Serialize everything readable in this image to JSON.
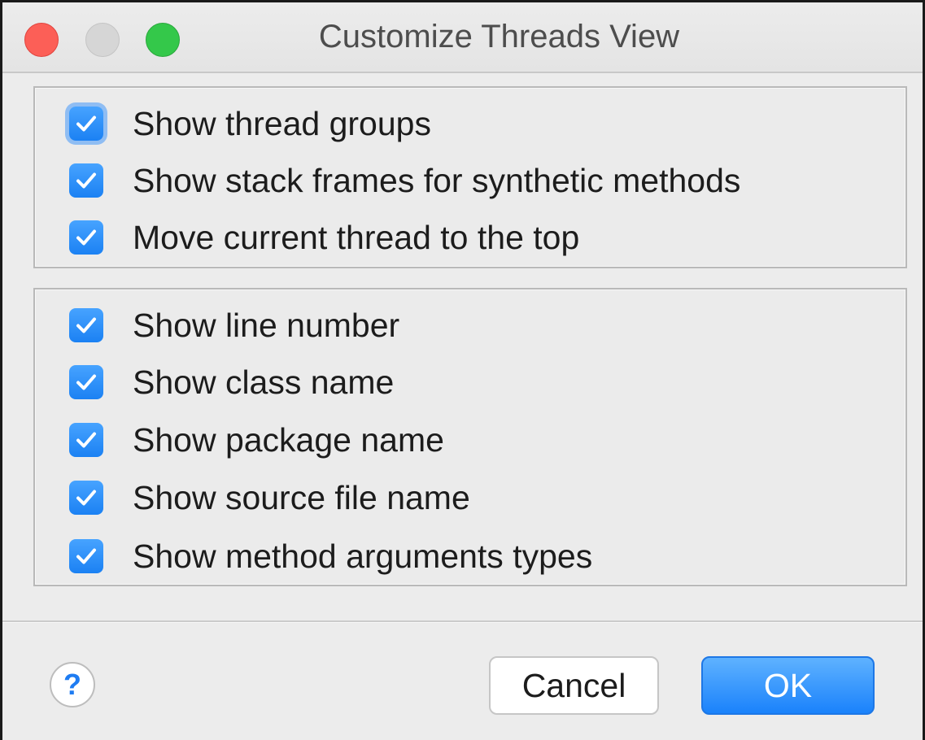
{
  "window": {
    "title": "Customize Threads View"
  },
  "groups": [
    {
      "items": [
        {
          "label": "Show thread groups",
          "checked": true,
          "focused": true
        },
        {
          "label": "Show stack frames for synthetic methods",
          "checked": true
        },
        {
          "label": "Move current thread to the top",
          "checked": true
        }
      ]
    },
    {
      "items": [
        {
          "label": "Show line number",
          "checked": true
        },
        {
          "label": "Show class name",
          "checked": true
        },
        {
          "label": "Show package name",
          "checked": true
        },
        {
          "label": "Show source file name",
          "checked": true
        },
        {
          "label": "Show method arguments types",
          "checked": true
        }
      ]
    }
  ],
  "footer": {
    "help_label": "?",
    "cancel_label": "Cancel",
    "ok_label": "OK"
  },
  "colors": {
    "accent": "#1b81f3",
    "close": "#fc5f57",
    "maximize": "#34c84a"
  },
  "icons": {
    "checkbox": "checkmark-icon"
  }
}
